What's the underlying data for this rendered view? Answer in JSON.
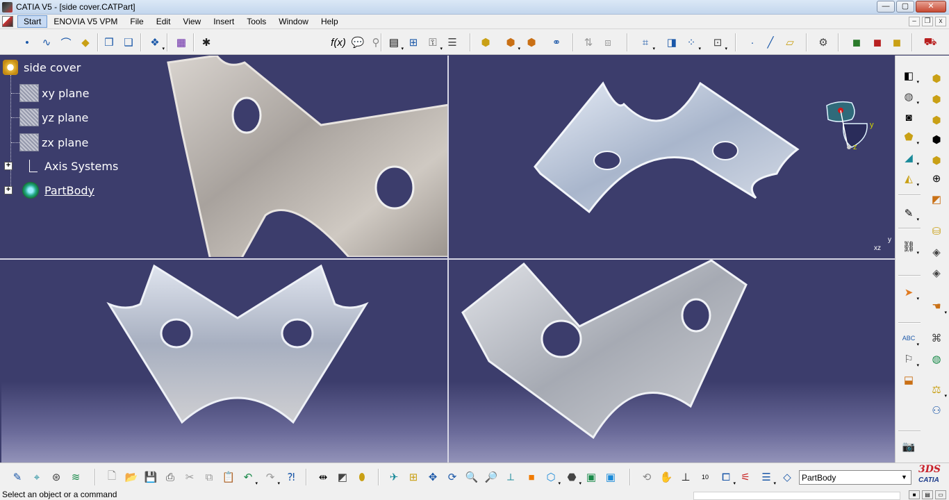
{
  "window": {
    "title": "CATIA V5 - [side cover.CATPart]",
    "controls": {
      "minimize": "—",
      "maximize": "▢",
      "close": "✕"
    }
  },
  "menubar": {
    "items": [
      {
        "label": "Start",
        "name": "menu-start"
      },
      {
        "label": "ENOVIA V5 VPM",
        "name": "menu-enovia"
      },
      {
        "label": "File",
        "name": "menu-file"
      },
      {
        "label": "Edit",
        "name": "menu-edit"
      },
      {
        "label": "View",
        "name": "menu-view"
      },
      {
        "label": "Insert",
        "name": "menu-insert"
      },
      {
        "label": "Tools",
        "name": "menu-tools"
      },
      {
        "label": "Window",
        "name": "menu-window"
      },
      {
        "label": "Help",
        "name": "menu-help"
      }
    ],
    "doc_controls": {
      "minimize": "–",
      "restore": "❐",
      "close": "x"
    }
  },
  "spec_tree": {
    "root": "side cover",
    "nodes": [
      {
        "label": "xy plane",
        "icon": "plane-icon"
      },
      {
        "label": "yz plane",
        "icon": "plane-icon"
      },
      {
        "label": "zx plane",
        "icon": "plane-icon"
      },
      {
        "label": "Axis Systems",
        "icon": "axis-system-icon",
        "expandable": "+"
      },
      {
        "label": "PartBody",
        "icon": "part-body-icon",
        "expandable": "+"
      }
    ]
  },
  "compass": {
    "y": "y",
    "z": "z"
  },
  "mini_axis": {
    "y": "y",
    "xz": "xz"
  },
  "current_body": {
    "value": "PartBody"
  },
  "brand": {
    "mark": "3DS",
    "name": "CATIA"
  },
  "status": {
    "message": "Select an object or a command"
  },
  "colors": {
    "viewport_bg": "#3c3d6c",
    "toolbar_bg": "#f0f0f0",
    "accent_blue": "#1a57a8"
  }
}
